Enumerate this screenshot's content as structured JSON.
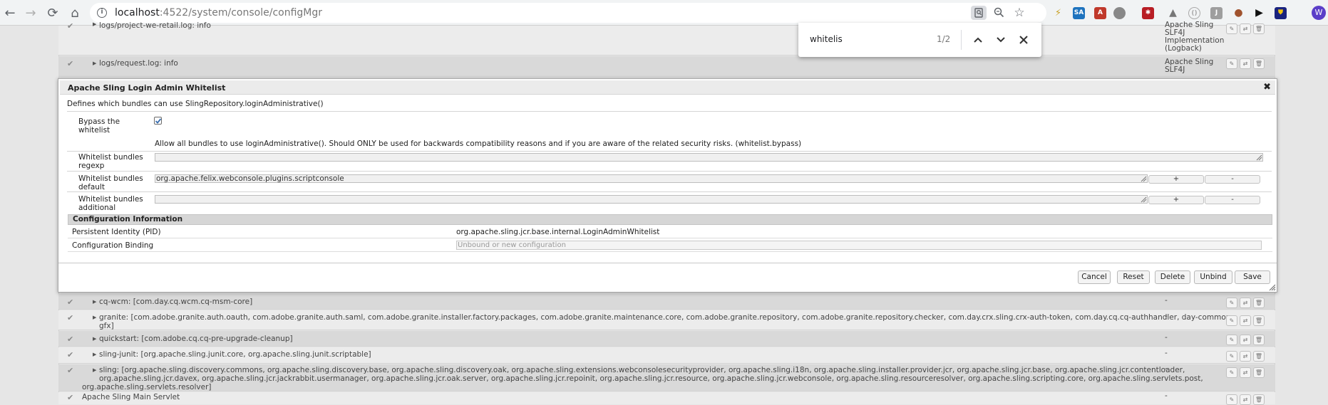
{
  "browser": {
    "url_host": "localhost",
    "url_rest": ":4522/system/console/configMgr",
    "find": {
      "query": "whitelis",
      "count": "1/2"
    },
    "profile_initial": "W"
  },
  "colors": {
    "accent": "#5b3ec8",
    "check": "#3a6fb0"
  },
  "list_top": [
    {
      "check": "✔",
      "text": "logs/project-we-retail.log: info",
      "source": "Apache Sling SLF4J Implementation (Logback)"
    },
    {
      "check": "✔",
      "text": "logs/request.log: info",
      "source": "Apache Sling SLF4J"
    }
  ],
  "list_bottom": [
    {
      "check": "✔",
      "text": "cq-wcm: [com.day.cq.wcm.cq-msm-core]",
      "source": "-"
    },
    {
      "check": "✔",
      "text": "granite: [com.adobe.granite.auth.oauth, com.adobe.granite.auth.saml, com.adobe.granite.installer.factory.packages, com.adobe.granite.maintenance.core, com.adobe.granite.repository, com.adobe.granite.repository.checker, com.day.crx.sling.crx-auth-token, com.day.cq.cq-authhandler, day-commons-",
      "text2": "gfx]",
      "source": "-"
    },
    {
      "check": "✔",
      "text": "quickstart: [com.adobe.cq.cq-pre-upgrade-cleanup]",
      "source": "-"
    },
    {
      "check": "✔",
      "text": "sling-junit: [org.apache.sling.junit.core, org.apache.sling.junit.scriptable]",
      "source": "-"
    },
    {
      "check": "✔",
      "text": "sling: [org.apache.sling.discovery.commons, org.apache.sling.discovery.base, org.apache.sling.discovery.oak, org.apache.sling.extensions.webconsolesecurityprovider, org.apache.sling.i18n, org.apache.sling.installer.provider.jcr, org.apache.sling.jcr.base, org.apache.sling.jcr.contentloader,",
      "text2": "org.apache.sling.jcr.davex, org.apache.sling.jcr.jackrabbit.usermanager, org.apache.sling.jcr.oak.server, org.apache.sling.jcr.repoinit, org.apache.sling.jcr.resource, org.apache.sling.jcr.webconsole, org.apache.sling.resourceresolver, org.apache.sling.scripting.core, org.apache.sling.servlets.post,",
      "text3": "org.apache.sling.servlets.resolver]",
      "source": "-"
    },
    {
      "check": "✔",
      "text": "Apache Sling Main Servlet",
      "source": "-"
    }
  ],
  "dialog": {
    "title": "Apache Sling Login Admin Whitelist",
    "close": "✖",
    "description": "Defines which bundles can use SlingRepository.loginAdministrative()",
    "bypass": {
      "label_line1": "Bypass the",
      "label_line2": "whitelist",
      "checked": true,
      "help": "Allow all bundles to use loginAdministrative(). Should ONLY be used for backwards compatibility reasons and if you are aware of the related security risks. (whitelist.bypass)"
    },
    "regexp": {
      "label_line1": "Whitelist bundles",
      "label_line2": "regexp",
      "value": ""
    },
    "default": {
      "label_line1": "Whitelist bundles",
      "label_line2": "default",
      "value": "org.apache.felix.webconsole.plugins.scriptconsole",
      "add": "+",
      "remove": "-"
    },
    "additional": {
      "label_line1": "Whitelist bundles",
      "label_line2": "additional",
      "value": "",
      "add": "+",
      "remove": "-"
    },
    "config_info": {
      "header": "Configuration Information",
      "pid_label": "Persistent Identity (PID)",
      "pid_value": "org.apache.sling.jcr.base.internal.LoginAdminWhitelist",
      "binding_label": "Configuration Binding",
      "binding_value": "Unbound or new configuration"
    },
    "buttons": {
      "cancel": "Cancel",
      "reset": "Reset",
      "delete": "Delete",
      "unbind": "Unbind",
      "save": "Save"
    }
  }
}
